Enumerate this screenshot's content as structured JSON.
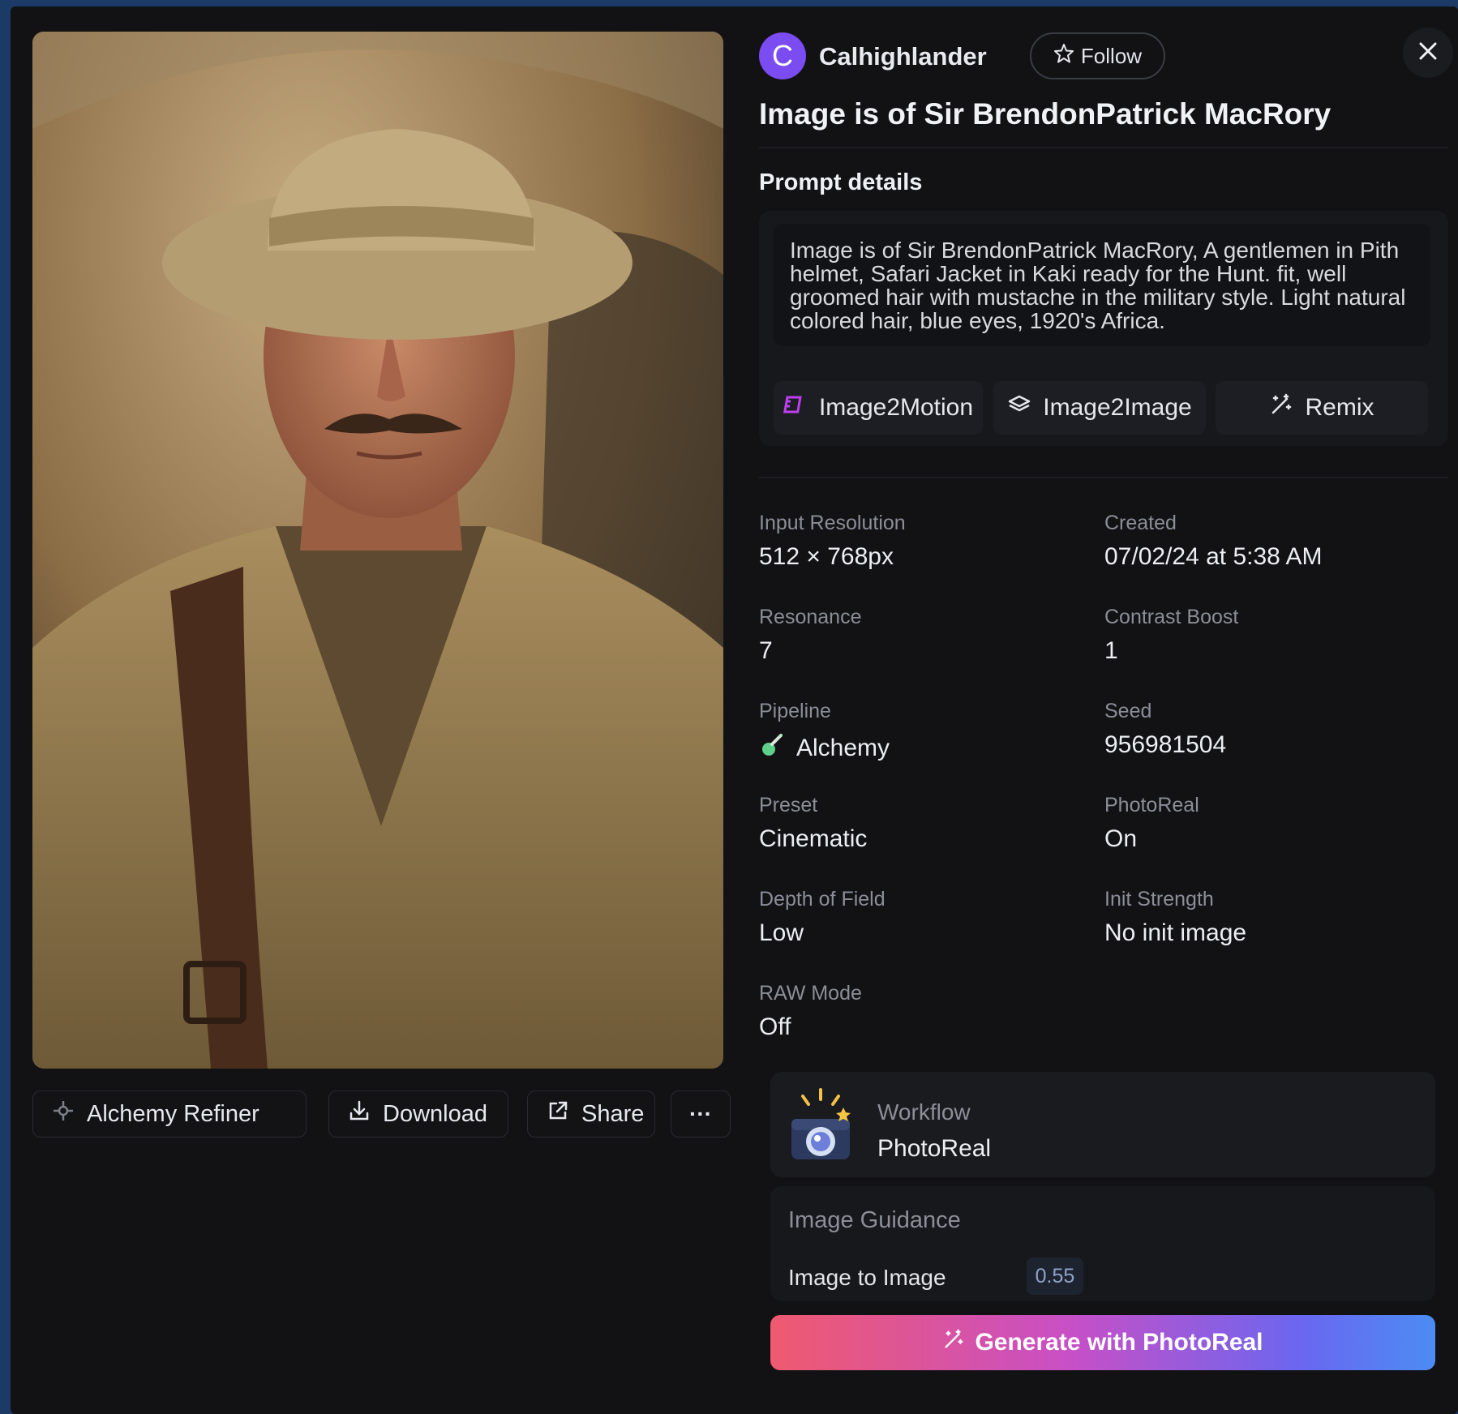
{
  "author": {
    "initial": "C",
    "name": "Calhighlander",
    "follow_label": "Follow"
  },
  "title": "Image is of Sir BrendonPatrick MacRory",
  "prompt": {
    "section_label": "Prompt details",
    "text": "Image is of Sir BrendonPatrick MacRory, A gentlemen in Pith helmet, Safari Jacket in Kaki ready for the Hunt. fit, well groomed hair with mustache in the military style. Light natural colored hair, blue eyes, 1920's Africa."
  },
  "modes": {
    "image2motion": "Image2Motion",
    "image2image": "Image2Image",
    "remix": "Remix"
  },
  "image_actions": {
    "refiner": "Alchemy Refiner",
    "download": "Download",
    "share": "Share",
    "more": "···"
  },
  "details": [
    {
      "label": "Input Resolution",
      "value": "512 × 768px"
    },
    {
      "label": "Created",
      "value": "07/02/24 at 5:38 AM"
    },
    {
      "label": "Resonance",
      "value": "7"
    },
    {
      "label": "Contrast Boost",
      "value": "1"
    },
    {
      "label": "Pipeline",
      "value": "Alchemy"
    },
    {
      "label": "Seed",
      "value": "956981504"
    },
    {
      "label": "Preset",
      "value": "Cinematic"
    },
    {
      "label": "PhotoReal",
      "value": "On"
    },
    {
      "label": "Depth of Field",
      "value": "Low"
    },
    {
      "label": "Init Strength",
      "value": "No init image"
    },
    {
      "label": "RAW Mode",
      "value": "Off"
    }
  ],
  "workflow": {
    "label": "Workflow",
    "value": "PhotoReal"
  },
  "guidance": {
    "title": "Image Guidance",
    "label": "Image to Image",
    "value": "0.55"
  },
  "generate_label": "Generate with PhotoReal",
  "colors": {
    "accent": "#7a4cf2",
    "page_bg": "#1c3a66",
    "panel_bg": "#121214"
  },
  "icons": [
    "star-icon",
    "close-icon",
    "motion-icon",
    "layers-icon",
    "wand-icon",
    "refiner-icon",
    "download-icon",
    "share-icon",
    "potion-icon",
    "camera-icon"
  ]
}
